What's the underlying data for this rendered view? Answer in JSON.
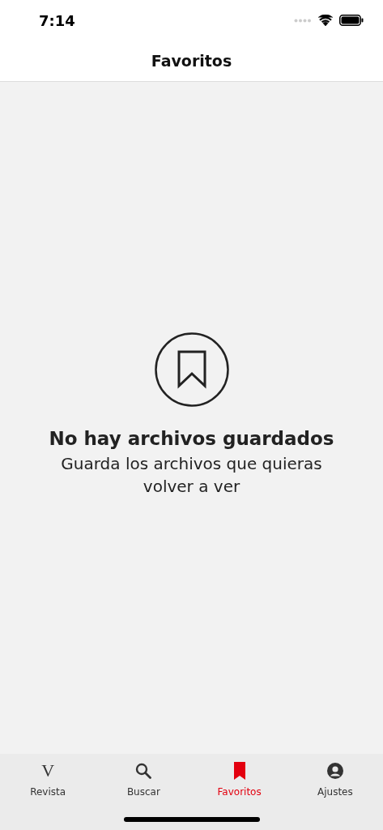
{
  "status_bar": {
    "time": "7:14"
  },
  "header": {
    "title": "Favoritos"
  },
  "empty_state": {
    "title": "No hay archivos guardados",
    "message": "Guarda los archivos que quieras volver a ver"
  },
  "tabs": [
    {
      "kind": "logo",
      "glyph": "V",
      "label": "Revista",
      "selected": false
    },
    {
      "kind": "search",
      "label": "Buscar",
      "selected": false
    },
    {
      "kind": "bookmark",
      "label": "Favoritos",
      "selected": true
    },
    {
      "kind": "profile",
      "label": "Ajustes",
      "selected": false
    }
  ]
}
